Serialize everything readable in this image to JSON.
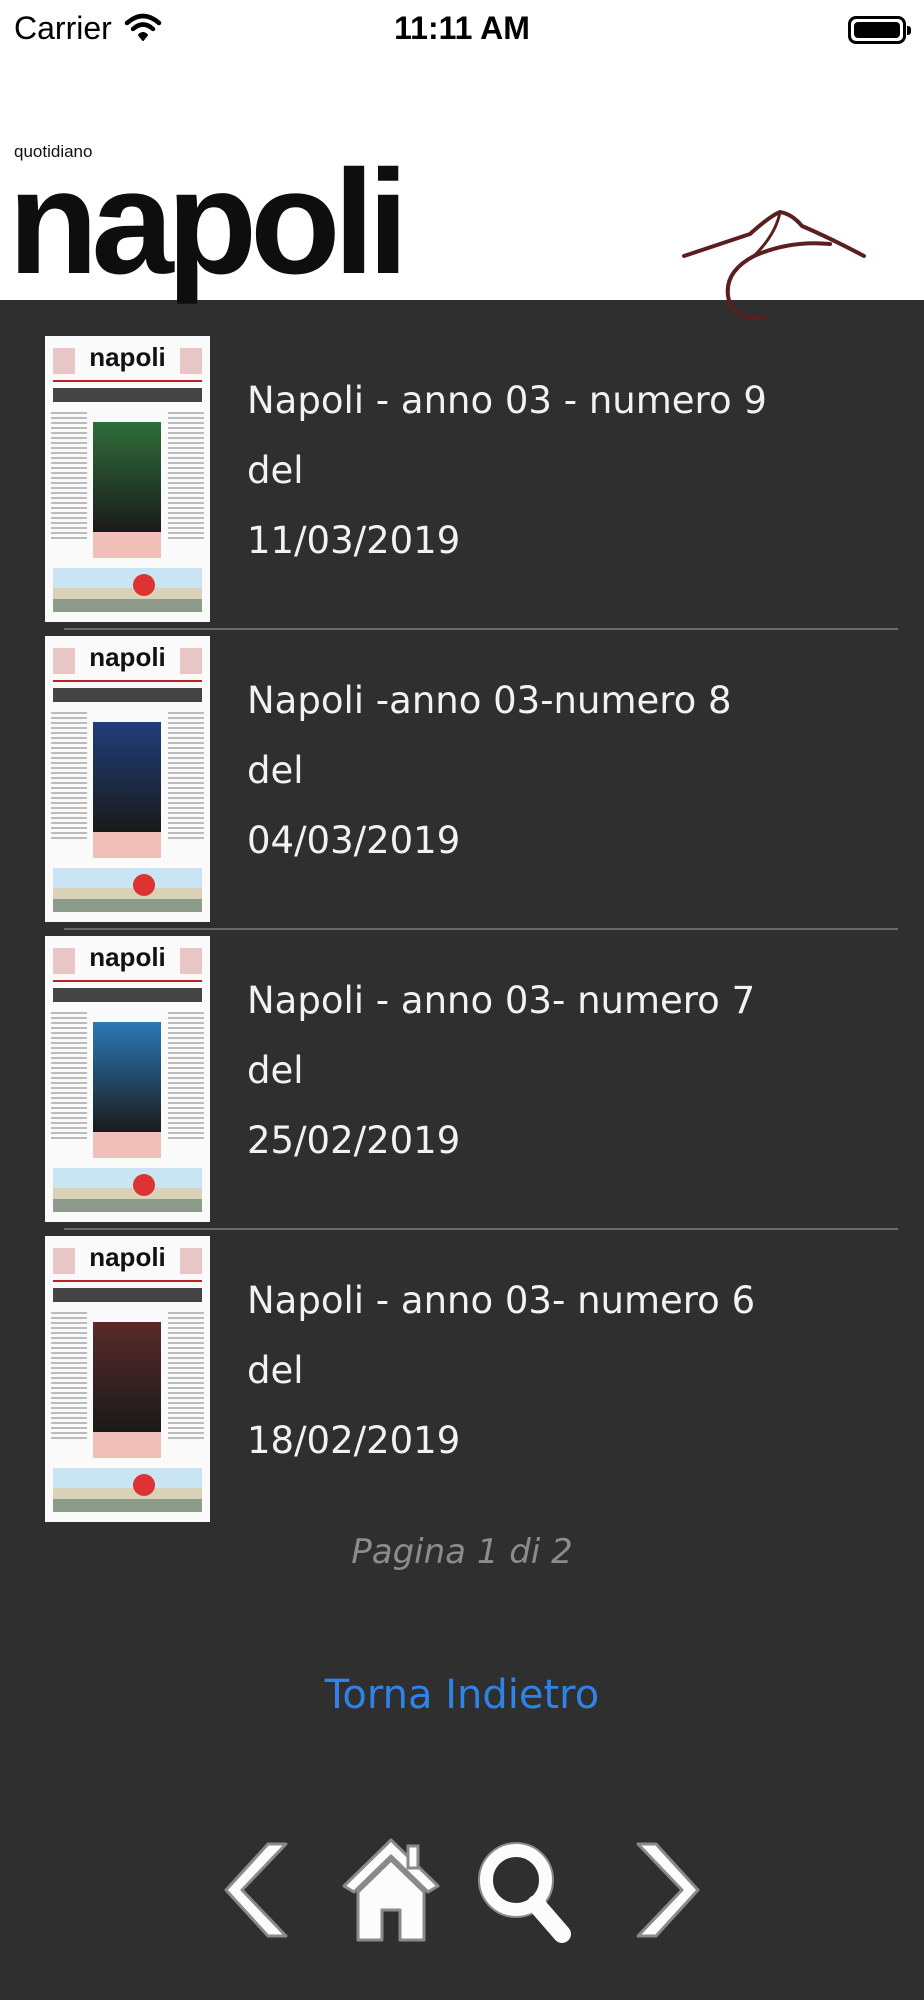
{
  "status_bar": {
    "carrier": "Carrier",
    "time": "11:11 AM"
  },
  "header": {
    "logo_small": "quotidiano",
    "logo_big": "napoli",
    "volcano_icon": "vesuvius-logo-icon",
    "volcano_color": "#5a1f1f"
  },
  "issues": [
    {
      "title": "Napoli - anno 03 - numero 9",
      "del": "del",
      "date": "11/03/2019",
      "thumb_title": "napoli",
      "photo_color": "#2f6e3a"
    },
    {
      "title": "Napoli -anno 03-numero 8",
      "del": "del",
      "date": "04/03/2019",
      "thumb_title": "napoli",
      "photo_color": "#1f3e7a"
    },
    {
      "title": "Napoli - anno 03- numero 7",
      "del": "del",
      "date": "25/02/2019",
      "thumb_title": "napoli",
      "photo_color": "#2a7ab8"
    },
    {
      "title": "Napoli - anno 03- numero 6",
      "del": "del",
      "date": "18/02/2019",
      "thumb_title": "napoli",
      "photo_color": "#5a2a2a"
    }
  ],
  "pager": {
    "text": "Pagina 1 di 2"
  },
  "back": {
    "label": "Torna Indietro",
    "color": "#2f82e8"
  },
  "toolbar": {
    "icons": [
      "chevron-left-icon",
      "home-icon",
      "search-icon",
      "chevron-right-icon"
    ]
  }
}
